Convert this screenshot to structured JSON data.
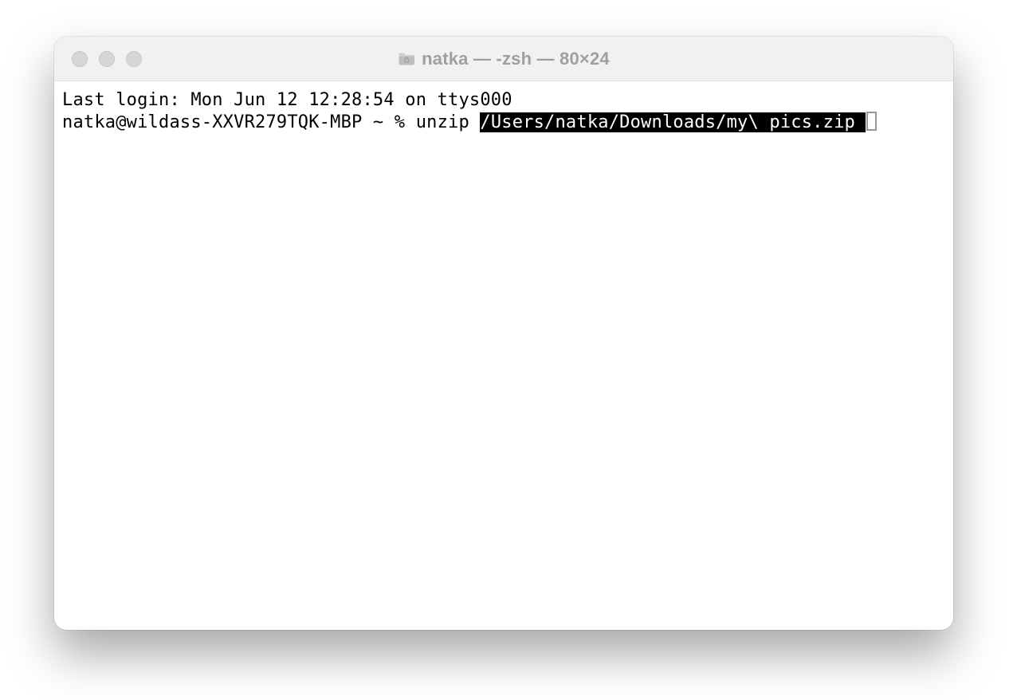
{
  "window": {
    "title": "natka — -zsh — 80×24"
  },
  "terminal": {
    "last_login": "Last login: Mon Jun 12 12:28:54 on ttys000",
    "prompt": "natka@wildass-XXVR279TQK-MBP ~ % ",
    "command_pre": "unzip ",
    "command_selected": "/Users/natka/Downloads/my\\ pics.zip "
  }
}
